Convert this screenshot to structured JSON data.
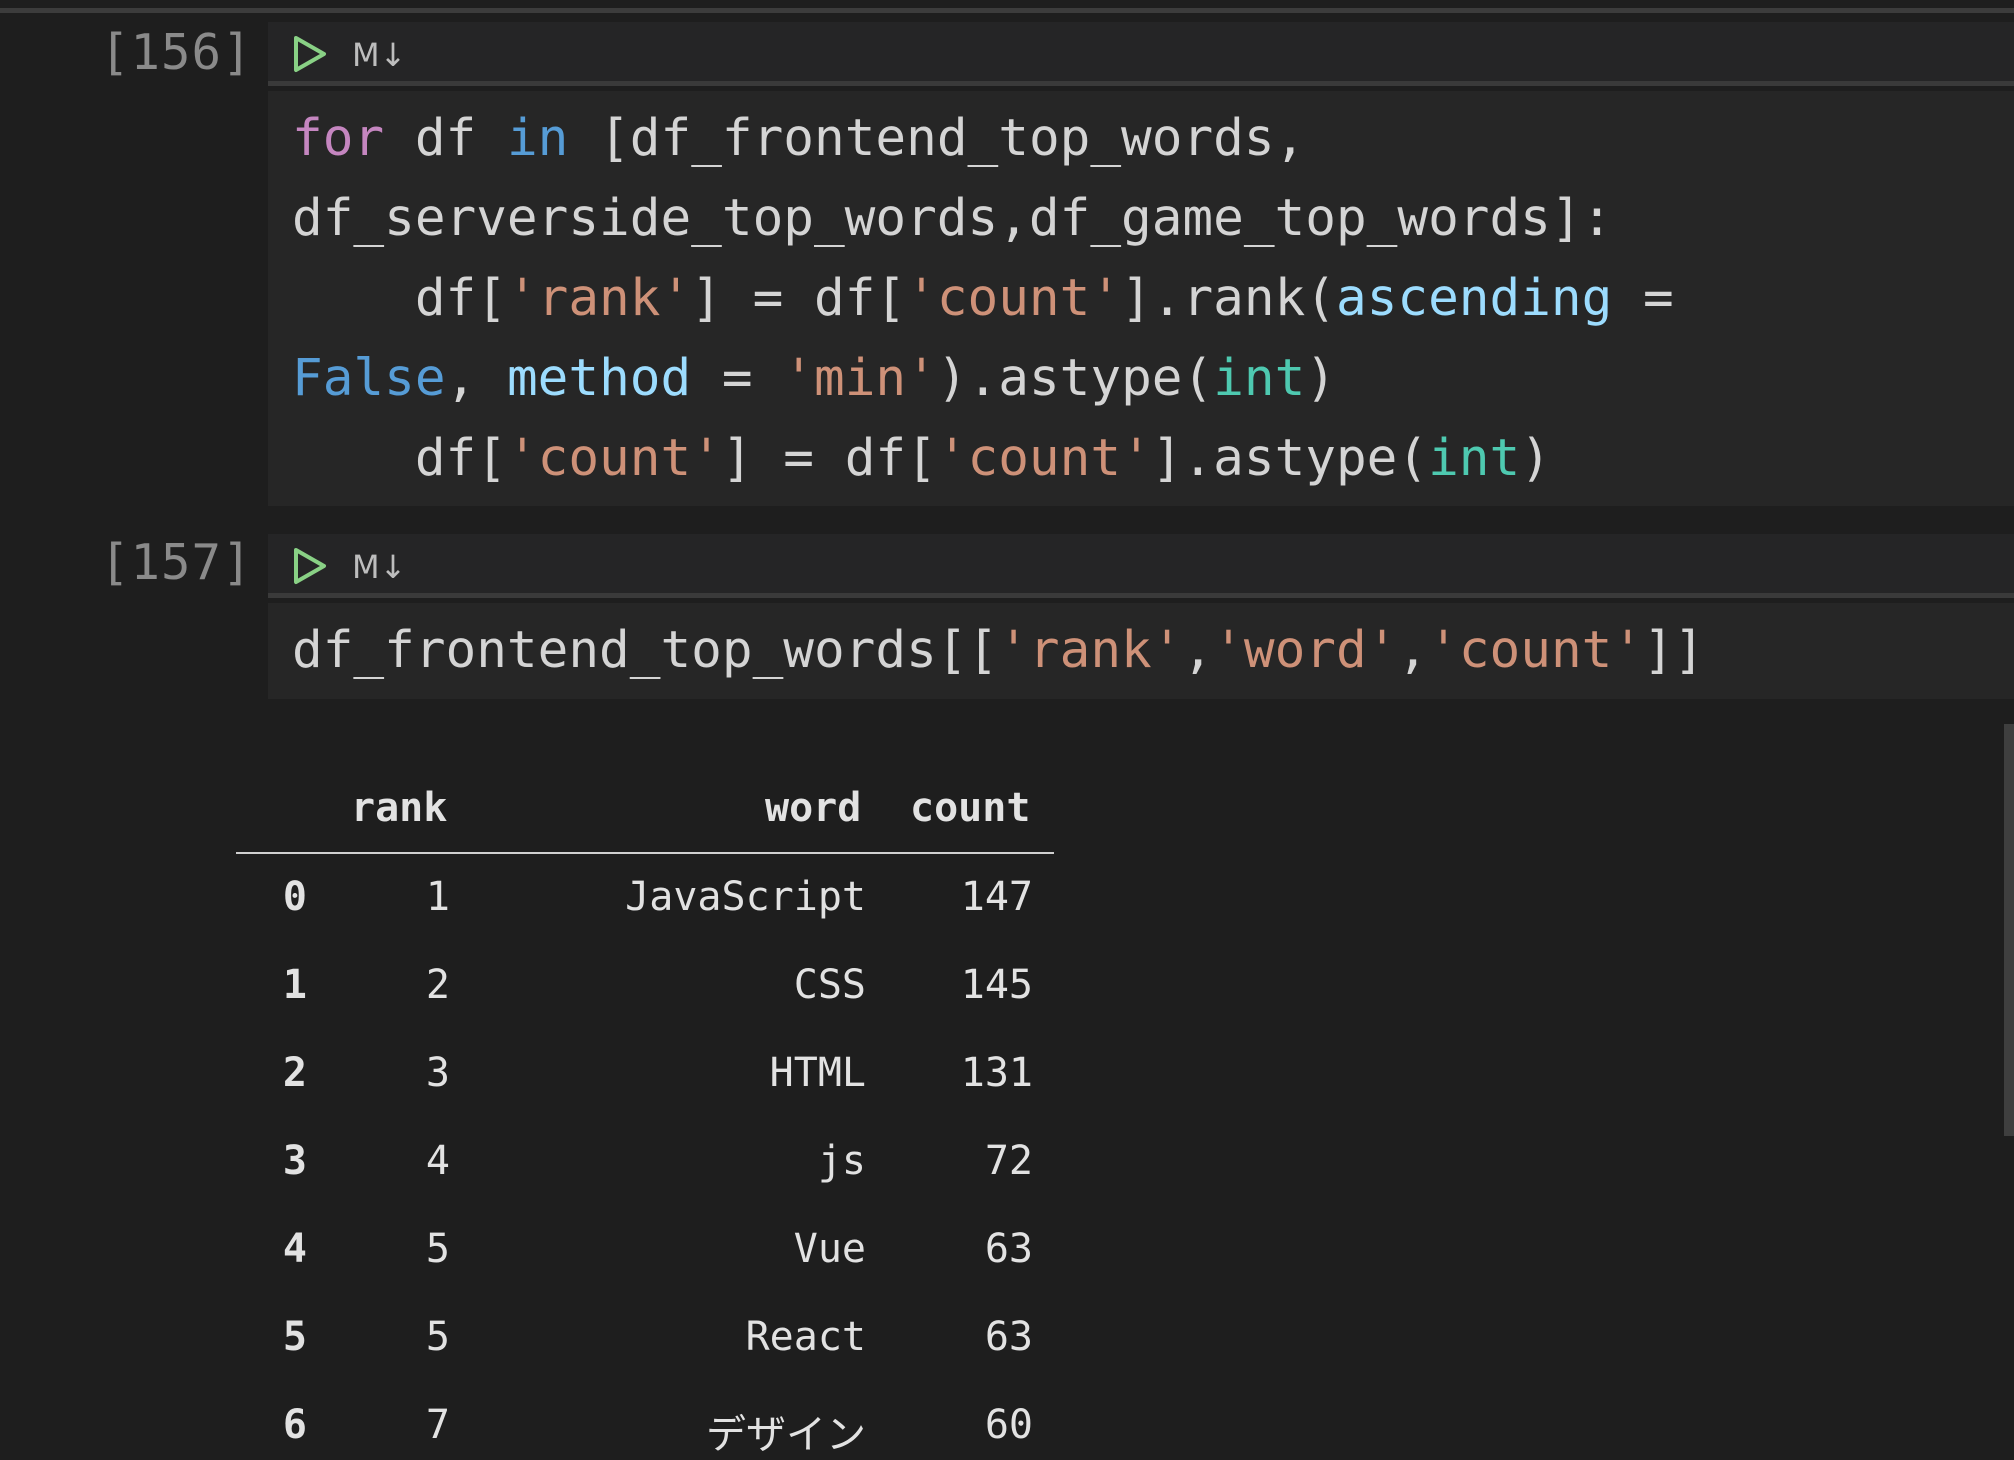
{
  "cells": [
    {
      "exec_count": "[156]",
      "toolbar": {
        "run_icon": "play-triangle-icon",
        "md_label": "M↓"
      },
      "code_lines": [
        [
          {
            "t": "for",
            "c": "kw-ctrl"
          },
          {
            "t": " df ",
            "c": "plain"
          },
          {
            "t": "in",
            "c": "kw"
          },
          {
            "t": " [df_frontend_top_words,",
            "c": "plain"
          }
        ],
        [
          {
            "t": "df_serverside_top_words,df_game_top_words]:",
            "c": "plain"
          }
        ],
        [
          {
            "t": "    df[",
            "c": "plain"
          },
          {
            "t": "'rank'",
            "c": "str"
          },
          {
            "t": "] = df[",
            "c": "plain"
          },
          {
            "t": "'count'",
            "c": "str"
          },
          {
            "t": "].rank(",
            "c": "plain"
          },
          {
            "t": "ascending",
            "c": "param"
          },
          {
            "t": " =",
            "c": "plain"
          }
        ],
        [
          {
            "t": "False",
            "c": "kw"
          },
          {
            "t": ", ",
            "c": "plain"
          },
          {
            "t": "method",
            "c": "param"
          },
          {
            "t": " = ",
            "c": "plain"
          },
          {
            "t": "'min'",
            "c": "str"
          },
          {
            "t": ").astype(",
            "c": "plain"
          },
          {
            "t": "int",
            "c": "type"
          },
          {
            "t": ")",
            "c": "plain"
          }
        ],
        [
          {
            "t": "    df[",
            "c": "plain"
          },
          {
            "t": "'count'",
            "c": "str"
          },
          {
            "t": "] = df[",
            "c": "plain"
          },
          {
            "t": "'count'",
            "c": "str"
          },
          {
            "t": "].astype(",
            "c": "plain"
          },
          {
            "t": "int",
            "c": "type"
          },
          {
            "t": ")",
            "c": "plain"
          }
        ]
      ]
    },
    {
      "exec_count": "[157]",
      "toolbar": {
        "run_icon": "play-triangle-icon",
        "md_label": "M↓"
      },
      "code_lines": [
        [
          {
            "t": "df_frontend_top_words[[",
            "c": "plain"
          },
          {
            "t": "'rank'",
            "c": "str"
          },
          {
            "t": ",",
            "c": "plain"
          },
          {
            "t": "'word'",
            "c": "str"
          },
          {
            "t": ",",
            "c": "plain"
          },
          {
            "t": "'count'",
            "c": "str"
          },
          {
            "t": "]]",
            "c": "plain"
          }
        ]
      ]
    }
  ],
  "output_table": {
    "headers": {
      "rank": "rank",
      "word": "word",
      "count": "count"
    },
    "rows": [
      {
        "index": "0",
        "rank": "1",
        "word": "JavaScript",
        "count": "147"
      },
      {
        "index": "1",
        "rank": "2",
        "word": "CSS",
        "count": "145"
      },
      {
        "index": "2",
        "rank": "3",
        "word": "HTML",
        "count": "131"
      },
      {
        "index": "3",
        "rank": "4",
        "word": "js",
        "count": "72"
      },
      {
        "index": "4",
        "rank": "5",
        "word": "Vue",
        "count": "63"
      },
      {
        "index": "5",
        "rank": "5",
        "word": "React",
        "count": "63"
      },
      {
        "index": "6",
        "rank": "7",
        "word": "デザイン",
        "count": "60"
      }
    ]
  },
  "colors": {
    "background": "#1e1e1e",
    "code_background": "#262626",
    "run_icon": "#89d185",
    "keyword_control": "#c586c0",
    "keyword": "#569cd6",
    "string": "#ce9178",
    "parameter": "#9cdcfe",
    "type": "#4ec9b0"
  }
}
